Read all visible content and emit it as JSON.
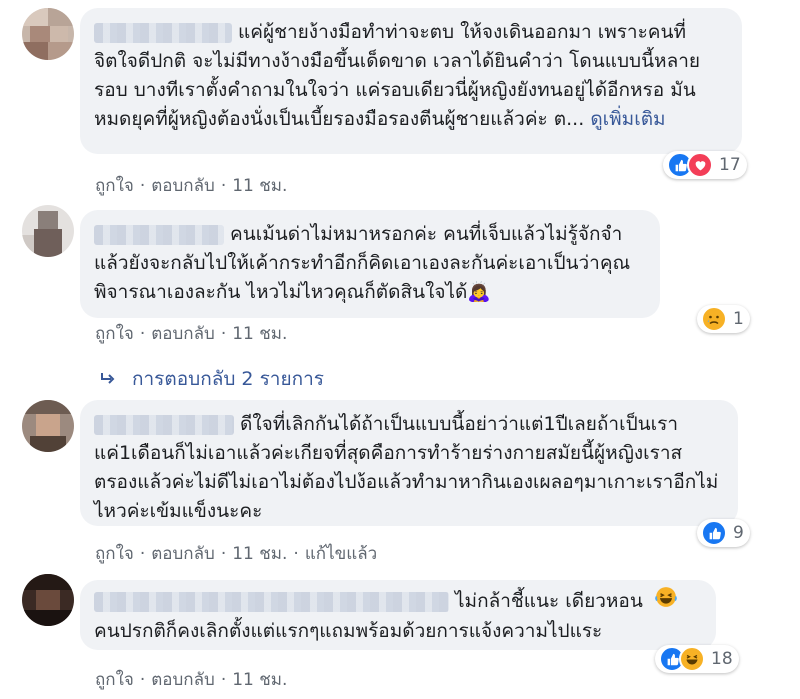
{
  "comments": [
    {
      "text": "แค่ผู้ชายง้างมือทำท่าจะตบ ให้จงเดินออกมา เพราะคนที่จิตใจดีปกติ จะไม่มีทางง้างมือขึ้นเด็ดขาด เวลาได้ยินคำว่า โดนแบบนี้หลายรอบ บางทีเราตั้งคำถามในใจว่า แค่รอบเดียวนี่ผู้หญิงยังทนอยู่ได้อีกหรอ มันหมดยุคที่ผู้หญิงต้องนั่งเป็นเบี้ยรองมือรองตีนผู้ชายแล้วค่ะ ต...",
      "see_more": "ดูเพิ่มเติม",
      "like": "ถูกใจ",
      "reply": "ตอบกลับ",
      "time": "11 ชม.",
      "reaction_count": "17"
    },
    {
      "text": "คนเม้นด่าไม่หมาหรอกค่ะ คนที่เจ็บแล้วไม่รู้จักจำแล้วยังจะกลับไปให้เค้ากระทำอีกก็คิดเอาเองละกันค่ะเอาเป็นว่าคุณพิจารณาเองละกัน ไหวไม่ไหวคุณก็ตัดสินใจได้",
      "emoji": "🙇‍♀️",
      "like": "ถูกใจ",
      "reply": "ตอบกลับ",
      "time": "11 ชม.",
      "reaction_count": "1"
    },
    {
      "text": "ดีใจที่เลิกกันได้ถ้าเป็นแบบนี้อย่าว่าแต่1ปีเลยถ้าเป็นเราแค่1เดือนก็ไม่เอาแล้วค่ะเกียจที่สุดคือการทำร้ายร่างกายสมัยนี้ผู้หญิงเราสตรองแล้วค่ะไม่ดีไม่เอาไม่ต้องไปง้อแล้วทำมาหากินเองเผลอๆมาเกาะเราอีกไม่ไหวค่ะเข้มแข็งนะคะ",
      "like": "ถูกใจ",
      "reply": "ตอบกลับ",
      "time": "11 ชม.",
      "edited": "แก้ไขแล้ว",
      "reaction_count": "9"
    },
    {
      "text": "ไม่กล้าชี้แนะ เดียวหอน",
      "text2": "คนปรกติก็คงเลิกตั้งแต่แรกๆแถมพร้อมด้วยการแจ้งความไปแระ",
      "like": "ถูกใจ",
      "reply": "ตอบกลับ",
      "time": "11 ชม.",
      "reaction_count": "18"
    }
  ],
  "replies_link": "การตอบกลับ 2 รายการ",
  "colors": {
    "bubble": "#f0f2f5",
    "link": "#385898",
    "like": "#1877f2",
    "love": "#f33e58",
    "emoji": "#f7b125",
    "meta": "#606770"
  }
}
